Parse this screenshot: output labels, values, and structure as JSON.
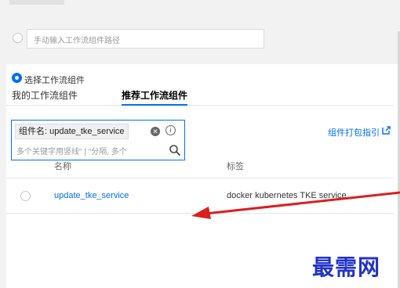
{
  "manual": {
    "placeholder": "手动输入工作流组件路径"
  },
  "select": {
    "label": "选择工作流组件"
  },
  "tabs": [
    {
      "label": "我的工作流组件",
      "active": false
    },
    {
      "label": "推荐工作流组件",
      "active": true
    }
  ],
  "search": {
    "tag": "组件名: update_tke_service",
    "placeholder": "多个关键字用竖线\" | \"分隔, 多个"
  },
  "guide_link": "组件打包指引",
  "table": {
    "headers": [
      "名称",
      "标签"
    ],
    "rows": [
      {
        "name": "update_tke_service",
        "tags": "docker kubernetes TKE service"
      }
    ]
  },
  "watermark": "最需网",
  "colors": {
    "accent": "#006eff",
    "arrow": "#d9201e",
    "watermark": "#2233c8"
  }
}
